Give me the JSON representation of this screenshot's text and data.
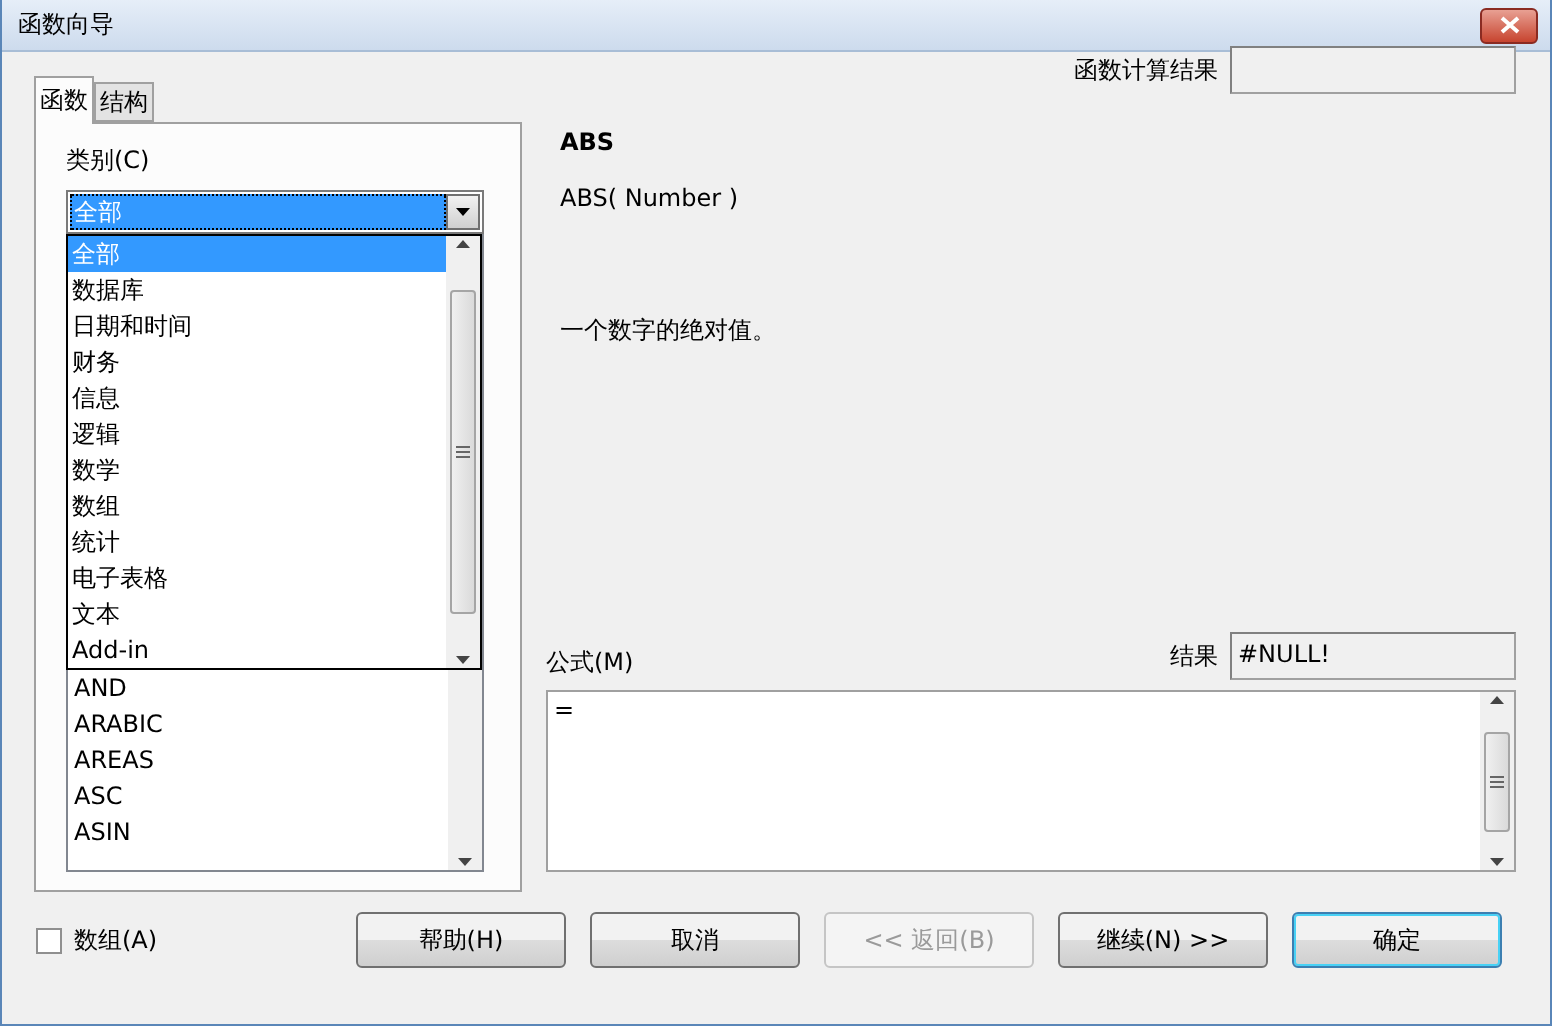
{
  "window": {
    "title": "函数向导"
  },
  "tabs": [
    {
      "label": "函数",
      "selected": true
    },
    {
      "label": "结构",
      "selected": false
    }
  ],
  "category": {
    "label": "类别(C)",
    "value": "全部",
    "options": [
      {
        "label": "全部",
        "selected": true
      },
      {
        "label": "数据库",
        "selected": false
      },
      {
        "label": "日期和时间",
        "selected": false
      },
      {
        "label": "财务",
        "selected": false
      },
      {
        "label": "信息",
        "selected": false
      },
      {
        "label": "逻辑",
        "selected": false
      },
      {
        "label": "数学",
        "selected": false
      },
      {
        "label": "数组",
        "selected": false
      },
      {
        "label": "统计",
        "selected": false
      },
      {
        "label": "电子表格",
        "selected": false
      },
      {
        "label": "文本",
        "selected": false
      },
      {
        "label": "Add-in",
        "selected": false
      }
    ]
  },
  "functions": [
    "AND",
    "ARABIC",
    "AREAS",
    "ASC",
    "ASIN"
  ],
  "function_result": {
    "label": "函数计算结果"
  },
  "function_name": "ABS",
  "syntax": "ABS( Number )",
  "description": "一个数字的绝对值。",
  "formula": {
    "label": "公式(M)",
    "value": "="
  },
  "result": {
    "label": "结果",
    "value": "#NULL!"
  },
  "array_checkbox": {
    "label": "数组(A)",
    "checked": false
  },
  "buttons": [
    {
      "label": "帮助(H)",
      "disabled": false,
      "default": false
    },
    {
      "label": "取消",
      "disabled": false,
      "default": false
    },
    {
      "label": "<< 返回(B)",
      "disabled": true,
      "default": false
    },
    {
      "label": "继续(N) >>",
      "disabled": false,
      "default": false
    },
    {
      "label": "确定",
      "disabled": false,
      "default": true
    }
  ]
}
